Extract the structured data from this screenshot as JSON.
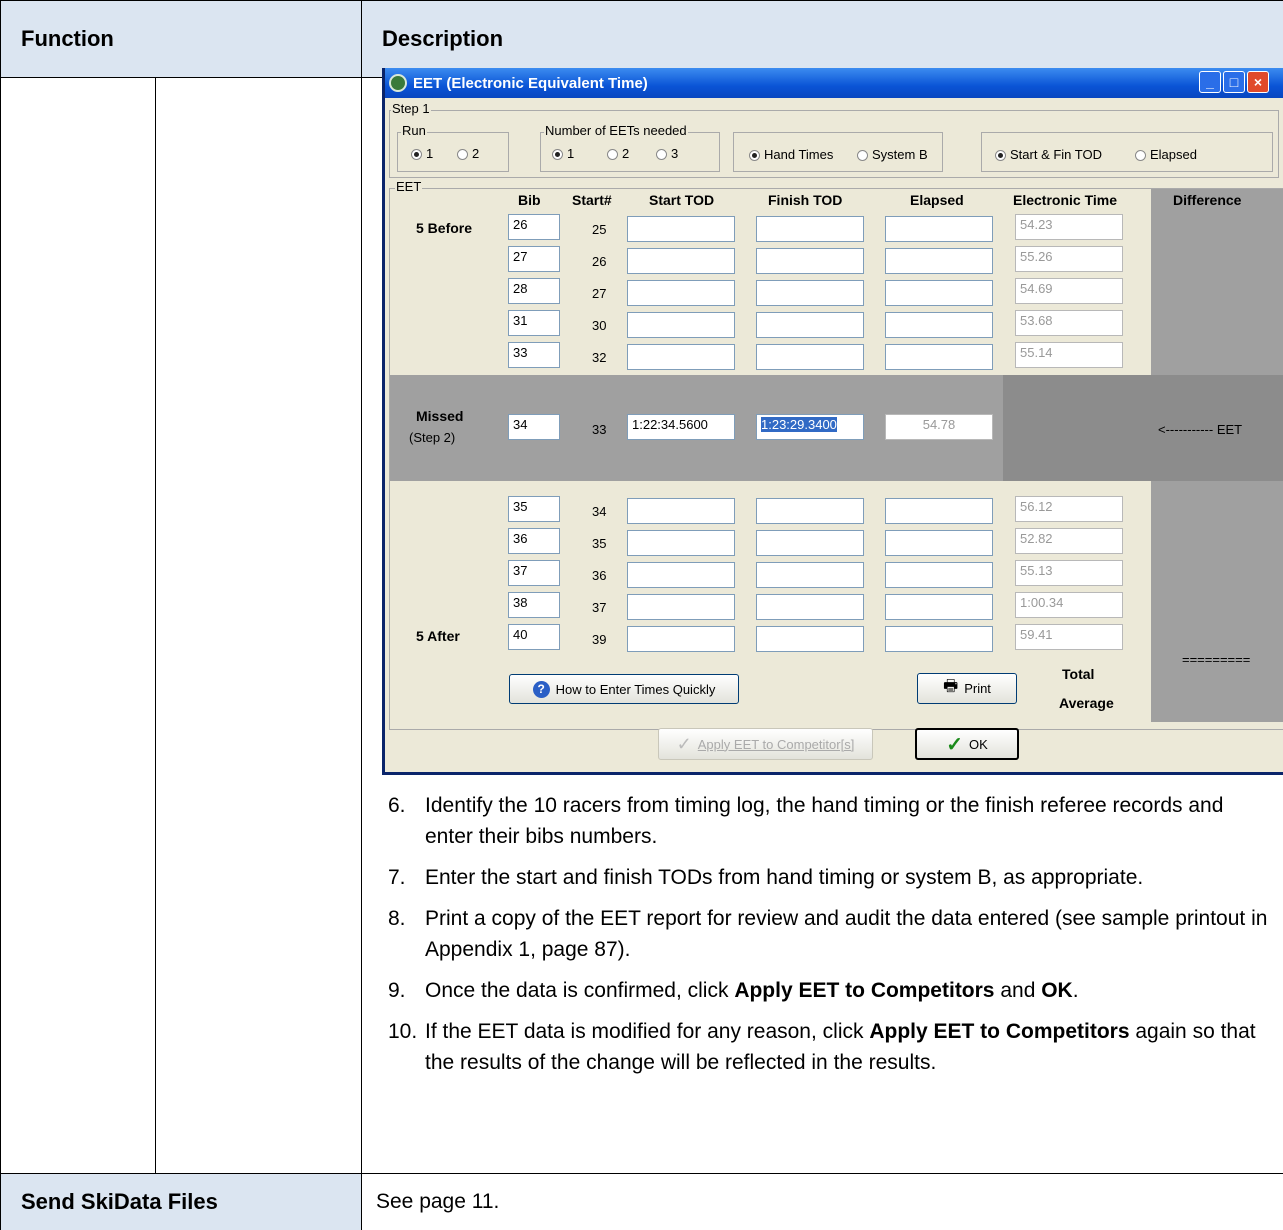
{
  "table": {
    "header": {
      "function": "Function",
      "description": "Description"
    },
    "footer_row": {
      "function": "Send SkiData Files",
      "description": "See page 11."
    }
  },
  "dialog": {
    "title": "EET (Electronic Equivalent Time)",
    "step1_label": "Step 1",
    "run": {
      "label": "Run",
      "options": [
        "1",
        "2"
      ],
      "selected": "1"
    },
    "eets_needed": {
      "label": "Number of EETs needed",
      "options": [
        "1",
        "2",
        "3"
      ],
      "selected": "1"
    },
    "source": {
      "options": [
        "Hand Times",
        "System B"
      ],
      "selected": "Hand Times"
    },
    "mode": {
      "options": [
        "Start & Fin TOD",
        "Elapsed"
      ],
      "selected": "Start & Fin TOD"
    },
    "eet_group_label": "EET",
    "columns": [
      "Bib",
      "Start#",
      "Start TOD",
      "Finish TOD",
      "Elapsed",
      "Electronic Time",
      "Difference"
    ],
    "five_before_label": "5 Before",
    "five_after_label": "5 After",
    "before_rows": [
      {
        "bib": "26",
        "start": "25",
        "etime": "54.23"
      },
      {
        "bib": "27",
        "start": "26",
        "etime": "55.26"
      },
      {
        "bib": "28",
        "start": "27",
        "etime": "54.69"
      },
      {
        "bib": "31",
        "start": "30",
        "etime": "53.68"
      },
      {
        "bib": "33",
        "start": "32",
        "etime": "55.14"
      }
    ],
    "missed": {
      "label": "Missed",
      "sub": "(Step 2)",
      "bib": "34",
      "start": "33",
      "start_tod": "1:22:34.5600",
      "finish_tod": "1:23:29.3400",
      "elapsed": "54.78",
      "arrow_text": "<----------- EET"
    },
    "after_rows": [
      {
        "bib": "35",
        "start": "34",
        "etime": "56.12"
      },
      {
        "bib": "36",
        "start": "35",
        "etime": "52.82"
      },
      {
        "bib": "37",
        "start": "36",
        "etime": "55.13"
      },
      {
        "bib": "38",
        "start": "37",
        "etime": "1:00.34"
      },
      {
        "bib": "40",
        "start": "39",
        "etime": "59.41"
      }
    ],
    "equals_line": "=========",
    "total_label": "Total",
    "average_label": "Average",
    "how_to_button": "How to Enter Times Quickly",
    "print_button": "Print",
    "apply_button": "Apply EET to Competitor[s]",
    "ok_button": "OK"
  },
  "steps": [
    {
      "num": "6.",
      "parts": [
        {
          "t": "Identify the 10 racers from timing log, the hand timing or the finish referee records and enter their bibs numbers.",
          "b": false
        }
      ]
    },
    {
      "num": "7.",
      "parts": [
        {
          "t": "Enter the start and finish TODs from hand timing or system B, as appropriate.",
          "b": false
        }
      ]
    },
    {
      "num": "8.",
      "parts": [
        {
          "t": "Print a copy of the EET report for review and audit the data entered (see sample printout in Appendix 1, page 87).",
          "b": false
        }
      ]
    },
    {
      "num": "9.",
      "parts": [
        {
          "t": "Once the data is confirmed, click ",
          "b": false
        },
        {
          "t": "Apply EET to Competitors",
          "b": true
        },
        {
          "t": " and ",
          "b": false
        },
        {
          "t": "OK",
          "b": true
        },
        {
          "t": ".",
          "b": false
        }
      ]
    },
    {
      "num": "10.",
      "parts": [
        {
          "t": "If the EET data is modified for any reason, click ",
          "b": false
        },
        {
          "t": "Apply EET to Competitors",
          "b": true
        },
        {
          "t": " again so that the results of the change will be reflected in the results.",
          "b": false
        }
      ]
    }
  ]
}
